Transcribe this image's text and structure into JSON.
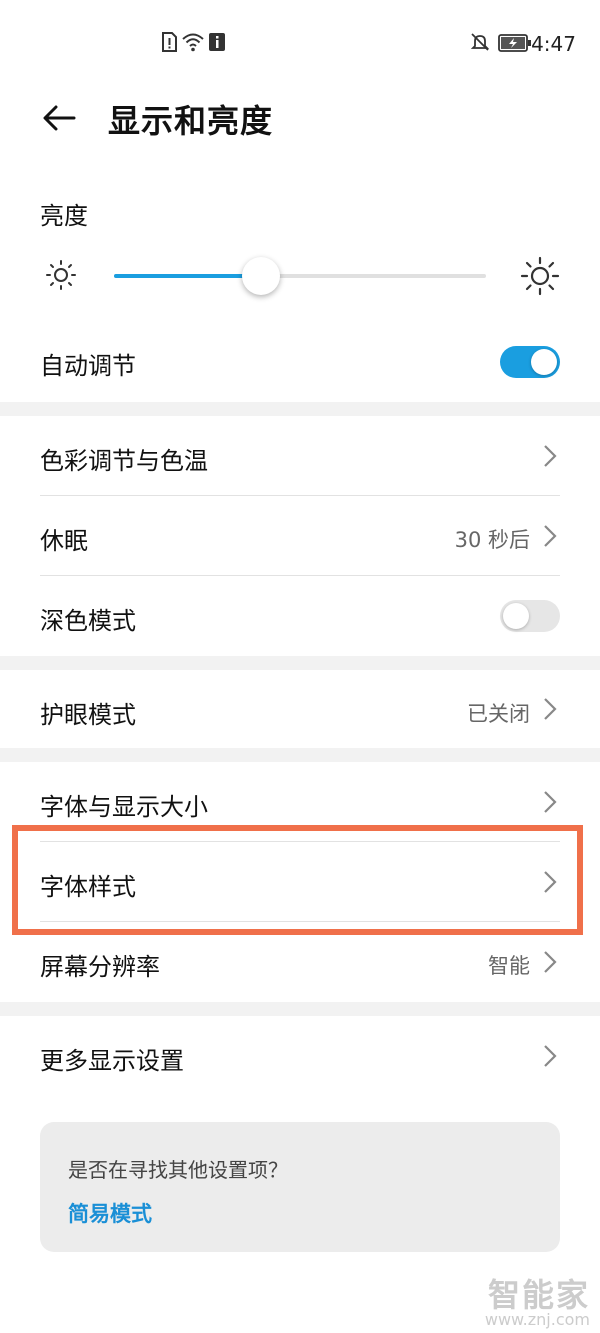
{
  "status_bar": {
    "time": "4:47"
  },
  "header": {
    "title": "显示和亮度"
  },
  "brightness": {
    "label": "亮度",
    "level_fraction": 0.395
  },
  "auto_adjust": {
    "label": "自动调节",
    "enabled": true
  },
  "section_color": {
    "items": [
      {
        "label": "色彩调节与色温",
        "value": ""
      },
      {
        "label": "休眠",
        "value": "30 秒后"
      },
      {
        "label": "深色模式",
        "toggle": false
      }
    ]
  },
  "section_eye": {
    "items": [
      {
        "label": "护眼模式",
        "value": "已关闭"
      }
    ]
  },
  "section_font": {
    "items": [
      {
        "label": "字体与显示大小",
        "value": ""
      },
      {
        "label": "字体样式",
        "value": ""
      },
      {
        "label": "屏幕分辨率",
        "value": "智能"
      }
    ]
  },
  "section_more": {
    "items": [
      {
        "label": "更多显示设置"
      }
    ]
  },
  "help": {
    "question": "是否在寻找其他设置项？",
    "link": "简易模式"
  },
  "watermark": {
    "brand": "智能家",
    "url": "www.znj.com"
  },
  "colors": {
    "accent": "#1a9ee0",
    "highlight": "#f0704a",
    "toggle_off": "#e6e6e6"
  }
}
